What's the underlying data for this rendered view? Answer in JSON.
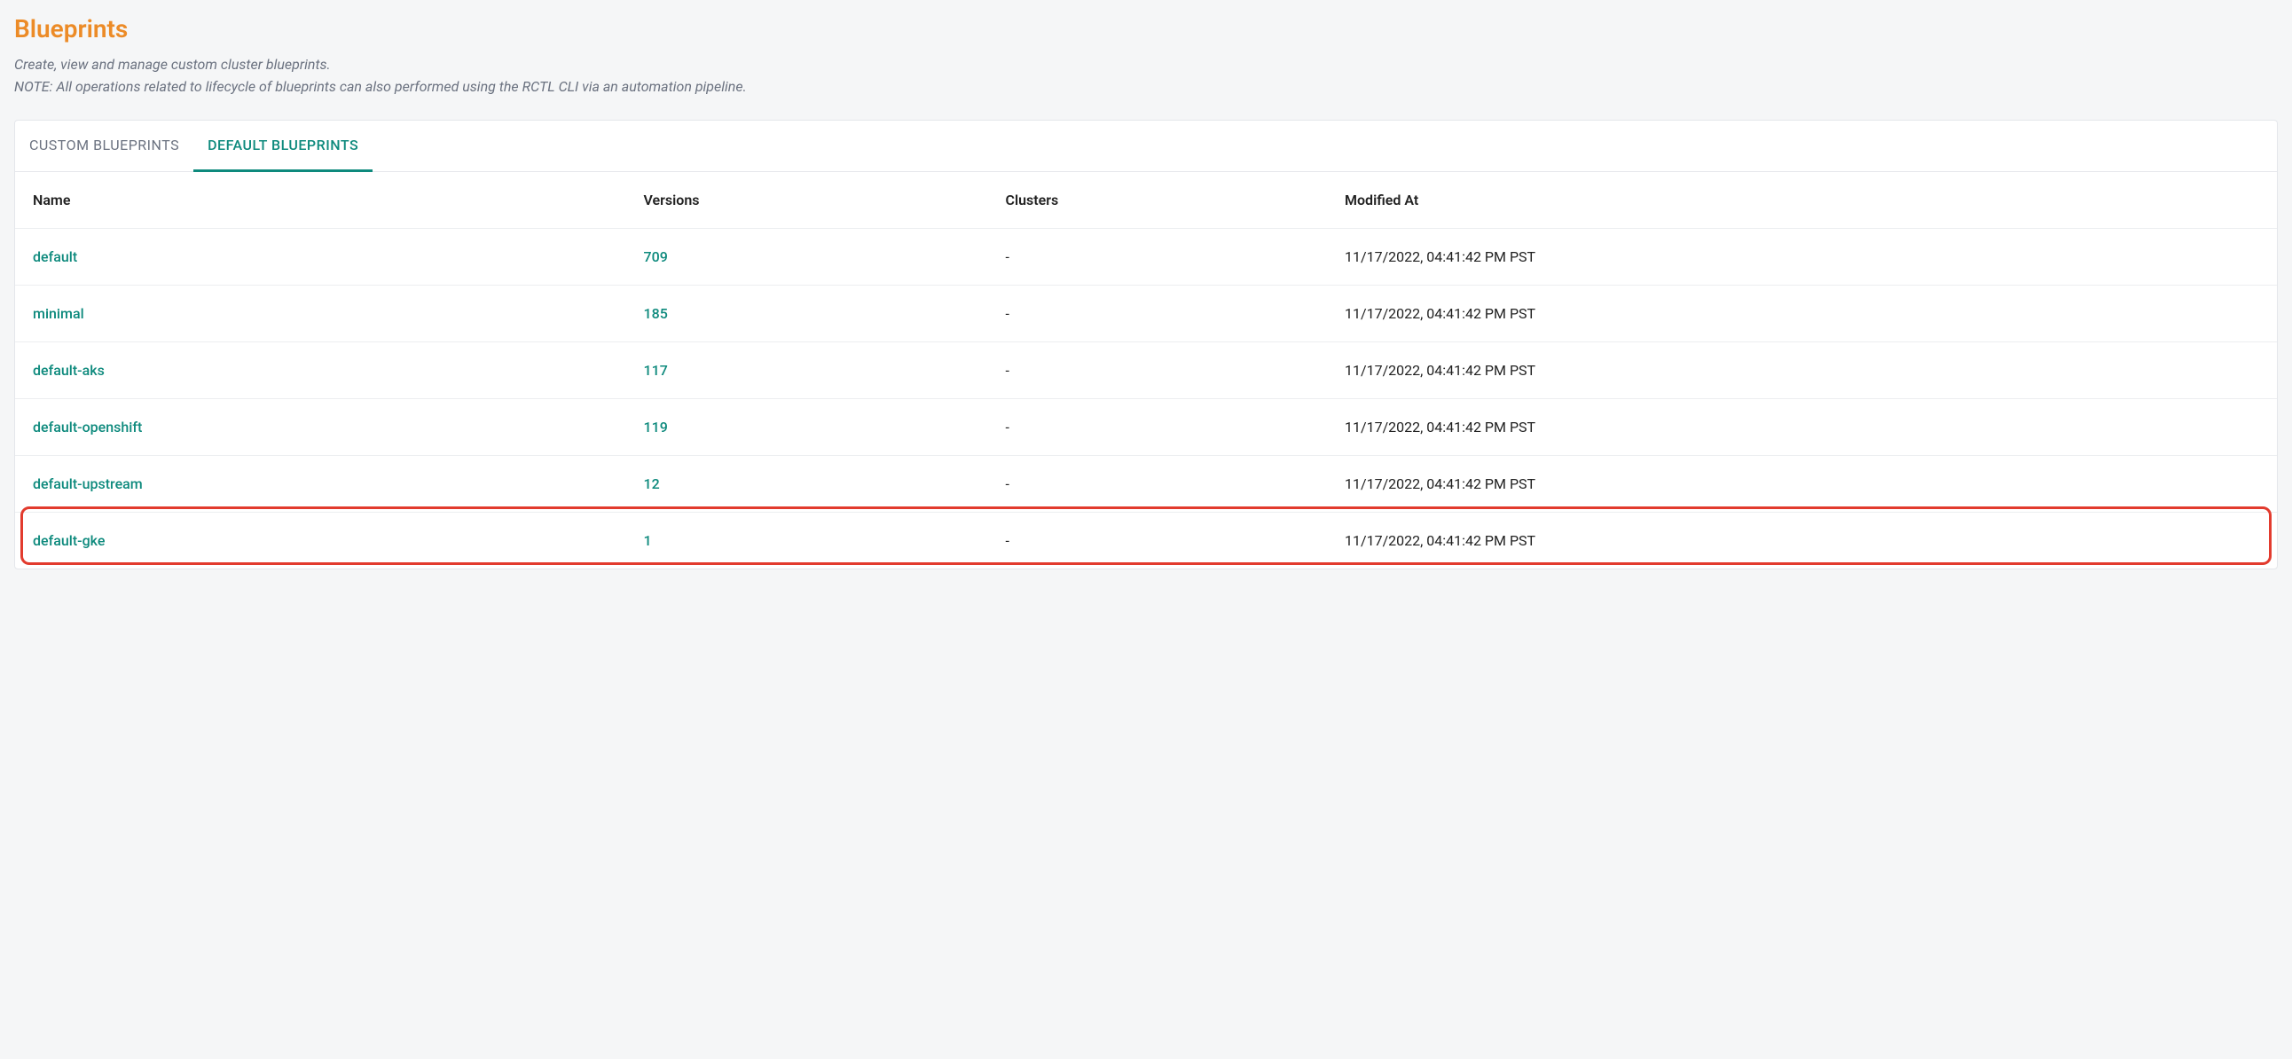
{
  "header": {
    "title": "Blueprints",
    "subtitle_line1": "Create, view and manage custom cluster blueprints.",
    "subtitle_line2": "NOTE: All operations related to lifecycle of blueprints can also performed using the RCTL CLI via an automation pipeline."
  },
  "tabs": {
    "custom": "CUSTOM BLUEPRINTS",
    "default": "DEFAULT BLUEPRINTS"
  },
  "table": {
    "headers": {
      "name": "Name",
      "versions": "Versions",
      "clusters": "Clusters",
      "modified": "Modified At"
    },
    "rows": [
      {
        "name": "default",
        "versions": "709",
        "clusters": "-",
        "modified": "11/17/2022, 04:41:42 PM PST"
      },
      {
        "name": "minimal",
        "versions": "185",
        "clusters": "-",
        "modified": "11/17/2022, 04:41:42 PM PST"
      },
      {
        "name": "default-aks",
        "versions": "117",
        "clusters": "-",
        "modified": "11/17/2022, 04:41:42 PM PST"
      },
      {
        "name": "default-openshift",
        "versions": "119",
        "clusters": "-",
        "modified": "11/17/2022, 04:41:42 PM PST"
      },
      {
        "name": "default-upstream",
        "versions": "12",
        "clusters": "-",
        "modified": "11/17/2022, 04:41:42 PM PST"
      },
      {
        "name": "default-gke",
        "versions": "1",
        "clusters": "-",
        "modified": "11/17/2022, 04:41:42 PM PST"
      }
    ]
  }
}
